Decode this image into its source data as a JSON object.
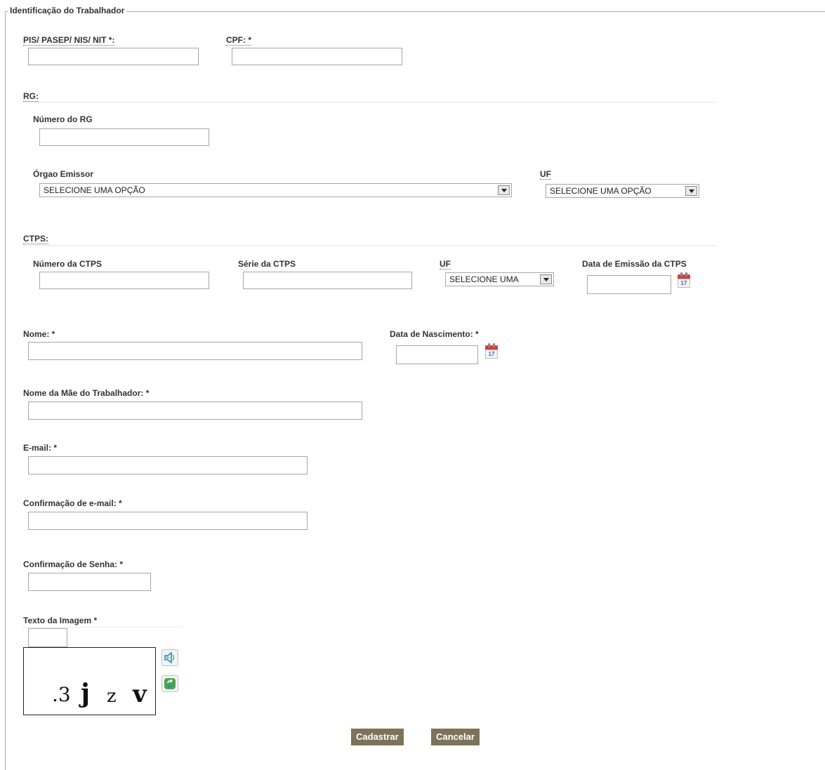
{
  "fieldset": {
    "legend": "Identificação do Trabalhador"
  },
  "pis": {
    "label": "PIS/ PASEP/ NIS/ NIT *:",
    "value": ""
  },
  "cpf": {
    "label": "CPF: *",
    "value": ""
  },
  "rg": {
    "section_label": "RG:",
    "numero_label": "Número do RG",
    "numero_value": "",
    "orgao_label": "Órgao Emissor",
    "orgao_selected": "SELECIONE UMA OPÇÃO",
    "uf_label": "UF",
    "uf_selected": "SELECIONE UMA OPÇÃO"
  },
  "ctps": {
    "section_label": "CTPS:",
    "numero_label": "Número da CTPS",
    "numero_value": "",
    "serie_label": "Série da CTPS",
    "serie_value": "",
    "uf_label": "UF",
    "uf_selected": "SELECIONE UMA",
    "data_label": "Data de Emissão da CTPS",
    "data_value": ""
  },
  "nome": {
    "label": "Nome: *",
    "value": ""
  },
  "nascimento": {
    "label": "Data de Nascimento: *",
    "value": ""
  },
  "mae": {
    "label": "Nome da Mãe do Trabalhador: *",
    "value": ""
  },
  "email": {
    "label": "E-mail: *",
    "value": ""
  },
  "email_confirm": {
    "label": "Confirmação de e-mail: *",
    "value": ""
  },
  "senha_confirm": {
    "label": "Confirmação de Senha: *",
    "value": ""
  },
  "captcha": {
    "label": "Texto da Imagem *",
    "value": "",
    "chars": [
      ".3",
      "j",
      "z",
      "v"
    ],
    "audio_icon": "speaker-icon",
    "refresh_icon": "refresh-icon"
  },
  "calendar_icon_day": "17",
  "buttons": {
    "submit": "Cadastrar",
    "cancel": "Cancelar"
  },
  "colors": {
    "button_bg": "#7d7359",
    "border": "#a6a6a6",
    "calendar_red": "#d64036"
  }
}
